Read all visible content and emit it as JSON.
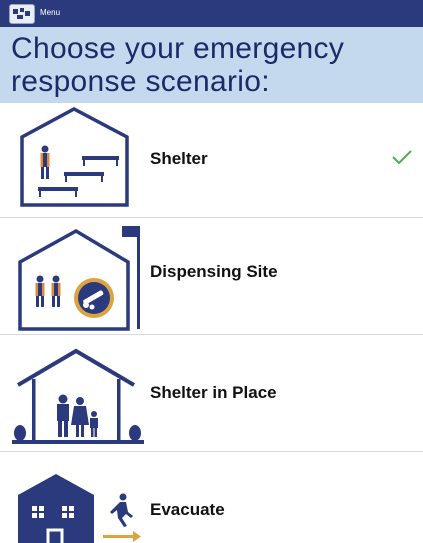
{
  "topbar": {
    "menu_label": "Menu",
    "app_icon": "app-logo-icon",
    "background": "#2a3a7c"
  },
  "header": {
    "title": "Choose your emergency response scenario:",
    "background": "#c4d9ee",
    "text_color": "#1b2b6a"
  },
  "scenarios": [
    {
      "label": "Shelter",
      "icon": "shelter-icon",
      "selected": true,
      "check_icon": "checkmark-icon"
    },
    {
      "label": "Dispensing Site",
      "icon": "dispensing-site-icon",
      "selected": false
    },
    {
      "label": "Shelter in Place",
      "icon": "shelter-in-place-icon",
      "selected": false
    },
    {
      "label": "Evacuate",
      "icon": "evacuate-icon",
      "selected": false
    }
  ],
  "colors": {
    "icon_navy": "#2a3a7c",
    "accent_orange": "#e08a3a",
    "check_green": "#4caf50",
    "arrow_gold": "#d9a441"
  }
}
